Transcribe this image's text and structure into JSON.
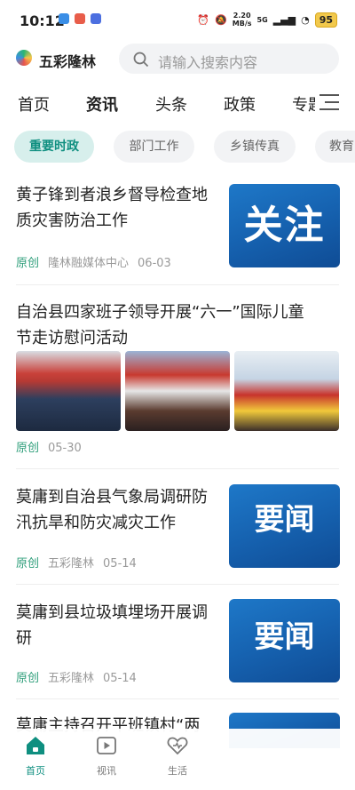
{
  "status_bar": {
    "time": "10:12",
    "net_speed_value": "2.20",
    "net_speed_unit": "MB/s",
    "signal": "5G",
    "battery": "95"
  },
  "header": {
    "brand": "五彩隆林",
    "search_placeholder": "请输入搜索内容"
  },
  "tabs": [
    {
      "label": "首页"
    },
    {
      "label": "资讯"
    },
    {
      "label": "头条"
    },
    {
      "label": "政策"
    },
    {
      "label": "专题"
    }
  ],
  "subtabs": [
    {
      "label": "重要时政"
    },
    {
      "label": "部门工作"
    },
    {
      "label": "乡镇传真"
    },
    {
      "label": "教育"
    }
  ],
  "articles": [
    {
      "title_line1": "黄子锋到者浪乡督导检查地",
      "title_line2": "质灾害防治工作",
      "tag": "原创",
      "source": "隆林融媒体中心",
      "date": "06-03",
      "thumb_text": "关注"
    },
    {
      "title_line1": "自治县四家班子领导开展“六一”国际儿童",
      "title_line2": "节走访慰问活动",
      "tag": "原创",
      "source": "",
      "date": "05-30"
    },
    {
      "title_line1": "莫庸到自治县气象局调研防",
      "title_line2": "汛抗旱和防灾减灾工作",
      "tag": "原创",
      "source": "五彩隆林",
      "date": "05-14",
      "thumb_text": "要闻"
    },
    {
      "title_line1": "莫庸到县垃圾填埋场开展调",
      "title_line2": "研",
      "tag": "原创",
      "source": "五彩隆林",
      "date": "05-14",
      "thumb_text": "要闻"
    },
    {
      "title_line1": "莫庸主持召开平班镇村“两",
      "title_line2": ""
    }
  ],
  "bottom_nav": [
    {
      "label": "首页"
    },
    {
      "label": "视讯"
    },
    {
      "label": "生活"
    }
  ],
  "colors": {
    "accent": "#0f8f80",
    "tag": "#2e9e7a",
    "thumb_blue": "#1662b0"
  }
}
